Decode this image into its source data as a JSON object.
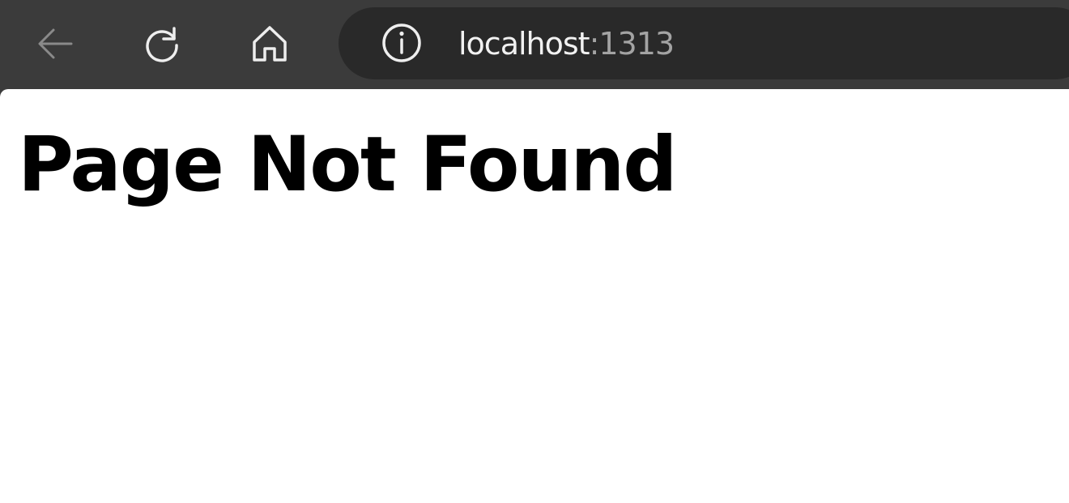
{
  "browser": {
    "address": {
      "host": "localhost",
      "port": ":1313"
    },
    "icons": {
      "back": "back-arrow-icon",
      "reload": "reload-icon",
      "home": "home-icon",
      "info": "info-icon"
    },
    "colors": {
      "toolbar": "#3b3b3b",
      "address_bar": "#292929",
      "host_text": "#f1f1f1",
      "port_text": "#a3a3a3"
    }
  },
  "page": {
    "title": "Page Not Found"
  }
}
